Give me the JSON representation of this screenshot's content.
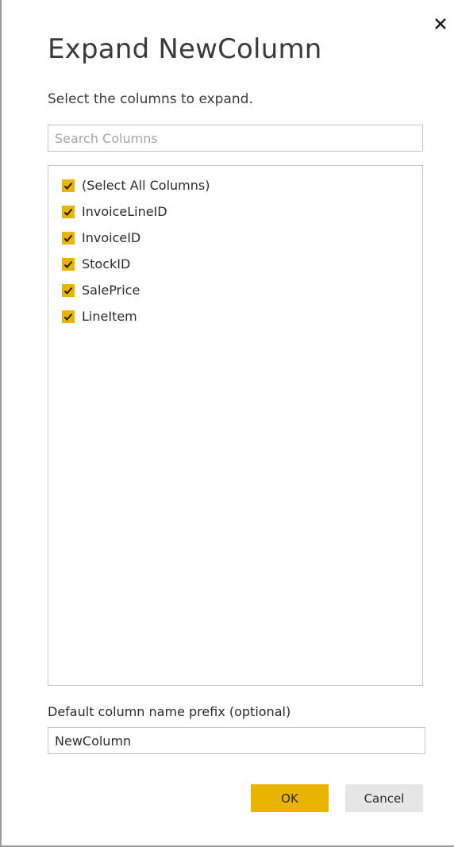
{
  "dialog": {
    "title": "Expand NewColumn",
    "subtitle": "Select the columns to expand.",
    "close_icon": "close-icon"
  },
  "search": {
    "placeholder": "Search Columns",
    "value": ""
  },
  "columns": [
    {
      "label": "(Select All Columns)",
      "checked": true
    },
    {
      "label": "InvoiceLineID",
      "checked": true
    },
    {
      "label": "InvoiceID",
      "checked": true
    },
    {
      "label": "StockID",
      "checked": true
    },
    {
      "label": "SalePrice",
      "checked": true
    },
    {
      "label": "LineItem",
      "checked": true
    }
  ],
  "prefix": {
    "label": "Default column name prefix (optional)",
    "value": "NewColumn"
  },
  "buttons": {
    "ok_label": "OK",
    "cancel_label": "Cancel"
  },
  "colors": {
    "accent": "#e8b400",
    "cancel_bg": "#e6e6e6",
    "border": "#c6c6c6"
  }
}
